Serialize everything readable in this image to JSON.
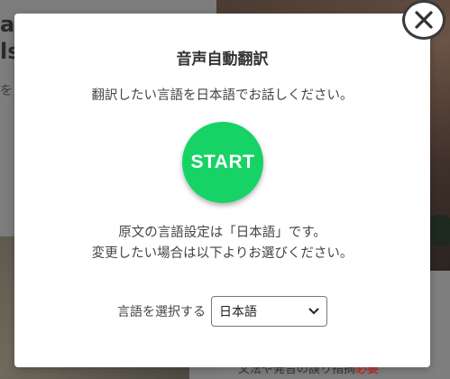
{
  "background": {
    "headline_lines": [
      "a",
      "ls"
    ],
    "side_snippet": "を",
    "bottom_text_prefix": "文法や発音の誤り指摘",
    "bottom_text_accent": "必要"
  },
  "modal": {
    "title": "音声自動翻訳",
    "instruction": "翻訳したい言語を日本語でお話しください。",
    "start_label": "START",
    "lang_info_line1": "原文の言語設定は「日本語」です。",
    "lang_info_line2": "変更したい場合は以下よりお選びください。",
    "lang_select_label": "言語を選択する",
    "lang_selected": "日本語"
  },
  "colors": {
    "start_button": "#17d366",
    "modal_bg": "#ffffff",
    "overlay": "#8a8a8a"
  },
  "icons": {
    "close": "close-icon",
    "dropdown": "chevron-down-icon"
  }
}
